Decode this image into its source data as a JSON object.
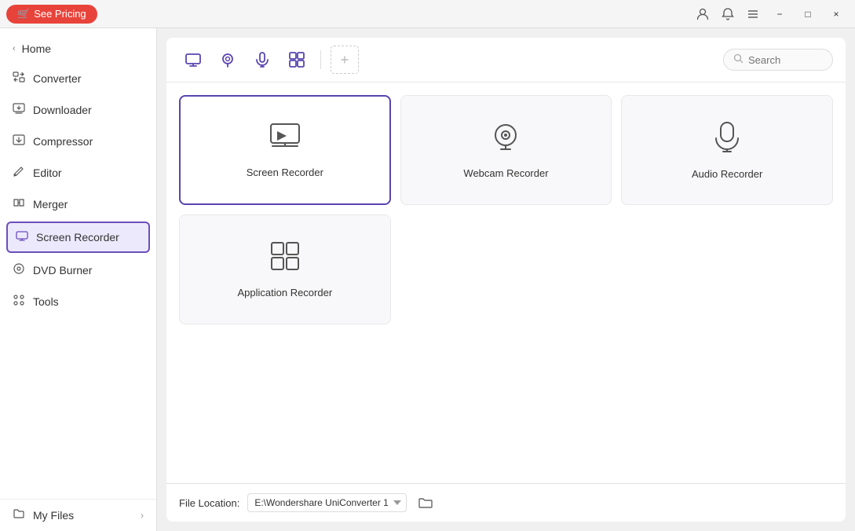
{
  "titlebar": {
    "see_pricing_label": "See Pricing",
    "minimize_label": "−",
    "maximize_label": "□",
    "close_label": "×"
  },
  "sidebar": {
    "home_label": "Home",
    "items": [
      {
        "id": "converter",
        "label": "Converter"
      },
      {
        "id": "downloader",
        "label": "Downloader"
      },
      {
        "id": "compressor",
        "label": "Compressor"
      },
      {
        "id": "editor",
        "label": "Editor"
      },
      {
        "id": "merger",
        "label": "Merger"
      },
      {
        "id": "screen-recorder",
        "label": "Screen Recorder",
        "active": true
      },
      {
        "id": "dvd-burner",
        "label": "DVD Burner"
      },
      {
        "id": "tools",
        "label": "Tools"
      }
    ],
    "my_files_label": "My Files"
  },
  "toolbar": {
    "search_placeholder": "Search"
  },
  "cards": [
    {
      "id": "screen-recorder",
      "label": "Screen Recorder",
      "selected": true
    },
    {
      "id": "webcam-recorder",
      "label": "Webcam Recorder",
      "selected": false
    },
    {
      "id": "audio-recorder",
      "label": "Audio Recorder",
      "selected": false
    },
    {
      "id": "application-recorder",
      "label": "Application Recorder",
      "selected": false
    }
  ],
  "footer": {
    "file_location_label": "File Location:",
    "file_path": "E:\\Wondershare UniConverter 1"
  }
}
